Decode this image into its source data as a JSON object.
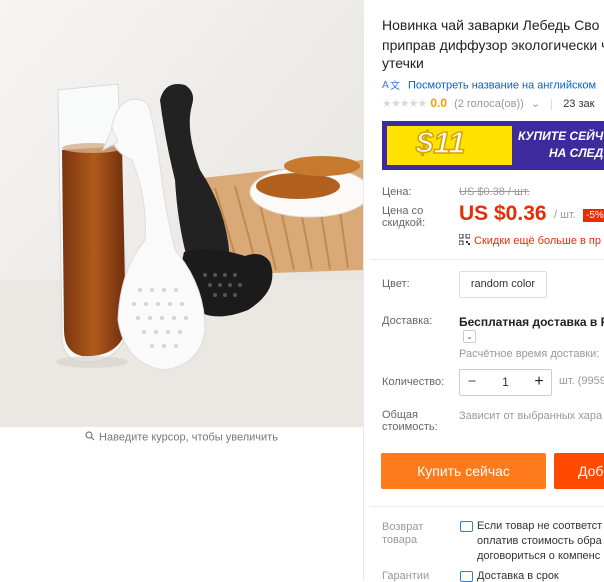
{
  "product": {
    "title_lines": [
      "Новинка чай заварки Лебедь Сво",
      "приправ диффузор экологически ч",
      "утечки"
    ],
    "translate_link": "Посмотреть название на английском",
    "rating_value": "0.0",
    "rating_votes": "(2 голоса(ов))",
    "orders": "23 зак",
    "zoom_hint": "Наведите курсор, чтобы увеличить"
  },
  "promo": {
    "price": "$11",
    "text_line1": "КУПИТЕ СЕЙЧ",
    "text_line2": "НА СЛЕД"
  },
  "price": {
    "label": "Цена:",
    "old": "US $0.38 / шт.",
    "sale_label_line1": "Цена со",
    "sale_label_line2": "скидкой:",
    "sale": "US $0.36",
    "per_unit": "/ шт.",
    "discount": "-5%",
    "coupon_text": "Скидки ещё больше в пр"
  },
  "options": {
    "color_label": "Цвет:",
    "color_value": "random color",
    "shipping_label": "Доставка:",
    "shipping_main": "Бесплатная доставка в Ru",
    "shipping_eta": "Расчётное время доставки:",
    "qty_label": "Количество:",
    "qty_value": "1",
    "qty_minus": "−",
    "qty_plus": "+",
    "qty_avail": "шт. (9959",
    "total_label_line1": "Общая",
    "total_label_line2": "стоимость:",
    "total_note": "Зависит от выбранных хара"
  },
  "actions": {
    "buy_now": "Купить сейчас",
    "add_cart": "Доб"
  },
  "guarantees": {
    "return_label_line1": "Возврат",
    "return_label_line2": "товара",
    "return_lines": [
      "Если товар не соответст",
      "оплатив стоимость обра",
      "договориться о компенс"
    ],
    "guarantee_label": "Гарантии",
    "guarantee_text": "Доставка в срок"
  },
  "icons": {
    "translate": "translate-icon",
    "magnifier": "magnifier-icon",
    "qr": "qr-code-icon",
    "return": "return-icon",
    "guarantee": "guarantee-icon"
  },
  "colors": {
    "accent_red": "#e62e04",
    "buy_orange": "#ff7a1a",
    "cart_orange": "#ff4a00",
    "promo_purple": "#3d2a9e",
    "promo_yellow": "#ffe200"
  }
}
